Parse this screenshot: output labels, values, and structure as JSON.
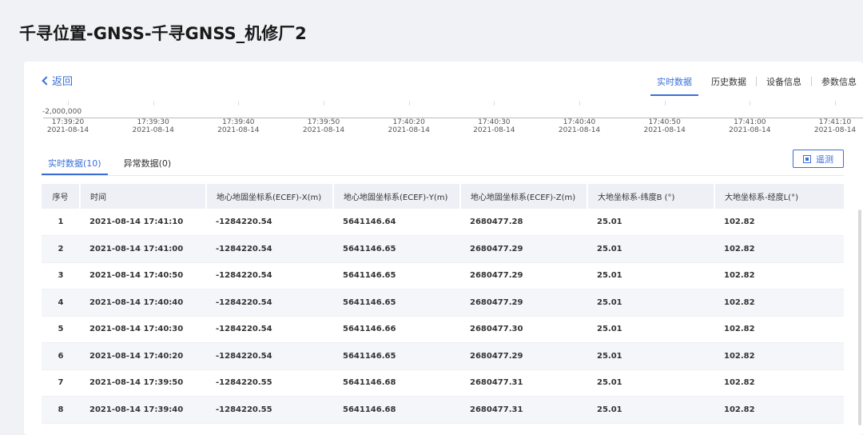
{
  "page": {
    "title": "千寻位置-GNSS-千寻GNSS_机修厂2"
  },
  "nav": {
    "back_label": "返回",
    "tabs": [
      {
        "label": "实时数据",
        "active": true
      },
      {
        "label": "历史数据",
        "active": false
      },
      {
        "label": "设备信息",
        "active": false
      },
      {
        "label": "参数信息",
        "active": false
      }
    ]
  },
  "chart": {
    "y_tick_label": "-2,000,000",
    "x_ticks": [
      {
        "time": "17:39:20",
        "date": "2021-08-14"
      },
      {
        "time": "17:39:30",
        "date": "2021-08-14"
      },
      {
        "time": "17:39:40",
        "date": "2021-08-14"
      },
      {
        "time": "17:39:50",
        "date": "2021-08-14"
      },
      {
        "time": "17:40:20",
        "date": "2021-08-14"
      },
      {
        "time": "17:40:30",
        "date": "2021-08-14"
      },
      {
        "time": "17:40:40",
        "date": "2021-08-14"
      },
      {
        "time": "17:40:50",
        "date": "2021-08-14"
      },
      {
        "time": "17:41:00",
        "date": "2021-08-14"
      },
      {
        "time": "17:41:10",
        "date": "2021-08-14"
      }
    ]
  },
  "data_tabs": [
    {
      "label": "实时数据(10)",
      "active": true
    },
    {
      "label": "异常数据(0)",
      "active": false
    }
  ],
  "measure_button": {
    "label": "遥测"
  },
  "colors": {
    "accent": "#3a6fd8",
    "header_bg": "#eef0f6",
    "row_alt_bg": "#f5f6fa"
  },
  "table": {
    "columns": [
      "序号",
      "时间",
      "地心地固坐标系(ECEF)-X(m)",
      "地心地固坐标系(ECEF)-Y(m)",
      "地心地固坐标系(ECEF)-Z(m)",
      "大地坐标系-纬度B (°)",
      "大地坐标系-经度L(°)"
    ],
    "rows": [
      [
        "1",
        "2021-08-14 17:41:10",
        "-1284220.54",
        "5641146.64",
        "2680477.28",
        "25.01",
        "102.82"
      ],
      [
        "2",
        "2021-08-14 17:41:00",
        "-1284220.54",
        "5641146.65",
        "2680477.29",
        "25.01",
        "102.82"
      ],
      [
        "3",
        "2021-08-14 17:40:50",
        "-1284220.54",
        "5641146.65",
        "2680477.29",
        "25.01",
        "102.82"
      ],
      [
        "4",
        "2021-08-14 17:40:40",
        "-1284220.54",
        "5641146.65",
        "2680477.29",
        "25.01",
        "102.82"
      ],
      [
        "5",
        "2021-08-14 17:40:30",
        "-1284220.54",
        "5641146.66",
        "2680477.30",
        "25.01",
        "102.82"
      ],
      [
        "6",
        "2021-08-14 17:40:20",
        "-1284220.54",
        "5641146.65",
        "2680477.29",
        "25.01",
        "102.82"
      ],
      [
        "7",
        "2021-08-14 17:39:50",
        "-1284220.55",
        "5641146.68",
        "2680477.31",
        "25.01",
        "102.82"
      ],
      [
        "8",
        "2021-08-14 17:39:40",
        "-1284220.55",
        "5641146.68",
        "2680477.31",
        "25.01",
        "102.82"
      ]
    ]
  }
}
